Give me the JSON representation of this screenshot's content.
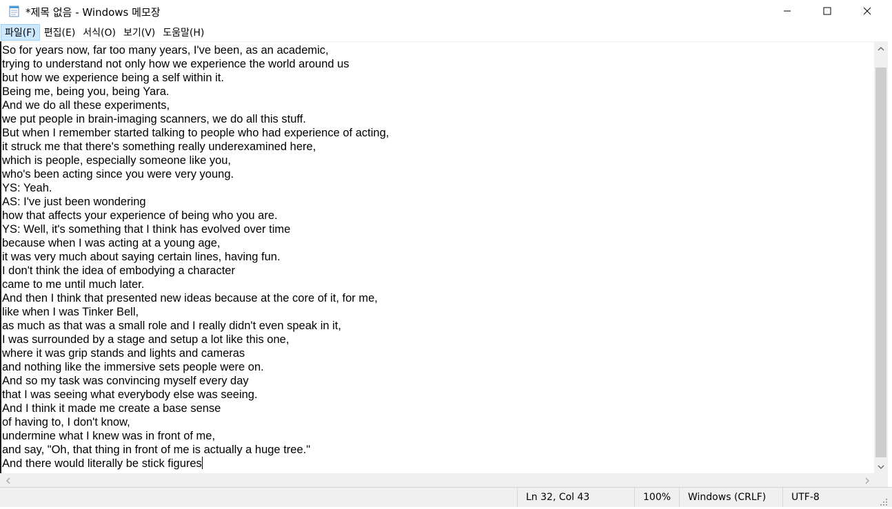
{
  "window": {
    "title": "*제목 없음 - Windows 메모장",
    "icon": "notepad-icon"
  },
  "controls": {
    "minimize_icon": "minimize-icon",
    "maximize_icon": "maximize-icon",
    "close_icon": "close-icon"
  },
  "menu": {
    "items": [
      {
        "label": "파일(F)",
        "active": true
      },
      {
        "label": "편집(E)",
        "active": false
      },
      {
        "label": "서식(O)",
        "active": false
      },
      {
        "label": "보기(V)",
        "active": false
      },
      {
        "label": "도움말(H)",
        "active": false
      }
    ]
  },
  "editor": {
    "lines": [
      "So for years now, far too many years, I've been, as an academic,",
      "trying to understand not only how we experience the world around us",
      "but how we experience being a self within it.",
      "Being me, being you, being Yara.",
      "And we do all these experiments,",
      "we put people in brain-imaging scanners, we do all this stuff.",
      "But when I remember started talking to people who had experience of acting,",
      "it struck me that there's something really underexamined here,",
      "which is people, especially someone like you,",
      "who's been acting since you were very young.",
      "YS: Yeah.",
      "AS: I've just been wondering",
      "how that affects your experience of being who you are.",
      "YS: Well, it's something that I think has evolved over time",
      "because when I was acting at a young age,",
      "it was very much about saying certain lines, having fun.",
      "I don't think the idea of embodying a character",
      "came to me until much later.",
      "And then I think that presented new ideas because at the core of it, for me,",
      "like when I was Tinker Bell,",
      "as much as that was a small role and I really didn't even speak in it,",
      "I was surrounded by a stage and setup a lot like this one,",
      "where it was grip stands and lights and cameras",
      "and nothing like the immersive sets people were on.",
      "And so my task was convincing myself every day",
      "that I was seeing what everybody else was seeing.",
      "And I think it made me create a base sense",
      "of having to, I don't know,",
      "undermine what I knew was in front of me,",
      "and say, \"Oh, that thing in front of me is actually a huge tree.\"",
      "And there would literally be stick figures"
    ]
  },
  "status": {
    "position": "Ln 32, Col 43",
    "zoom": "100%",
    "line_ending": "Windows (CRLF)",
    "encoding": "UTF-8"
  },
  "colors": {
    "menu_active_bg": "#cce8ff",
    "chrome_bg": "#f0f0f0",
    "scroll_thumb": "#cdcdcd"
  }
}
